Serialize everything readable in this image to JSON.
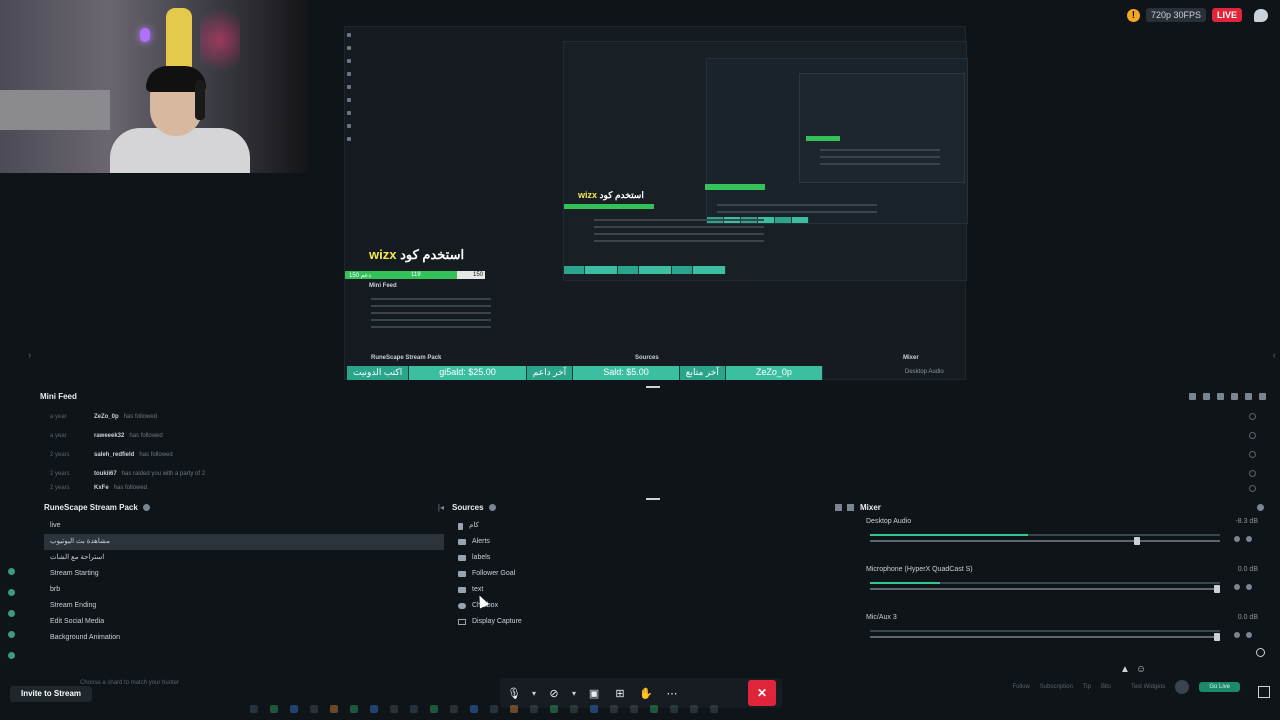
{
  "status": {
    "quality": "720p 30FPS",
    "live": "LIVE"
  },
  "preview": {
    "promo_text": "استخدم كود",
    "promo_code": "wizx",
    "ticker": [
      {
        "label": "اكتب الدونيت",
        "alt": false
      },
      {
        "label": "gi5ald: $25.00",
        "alt": true
      },
      {
        "label": "آخر داعم",
        "alt": false
      },
      {
        "label": "Sald: $5.00",
        "alt": true
      },
      {
        "label": "آخر متابع",
        "alt": false
      },
      {
        "label": "ZeZo_0p",
        "alt": true
      }
    ],
    "bar_left": "150 دعم",
    "bar_mid": "119",
    "bar_right": "150",
    "mini_feed_label": "Mini Feed",
    "rs_pack_label": "RuneScape Stream Pack",
    "sources_label": "Sources",
    "mixer_label": "Mixer",
    "desktop_audio_label": "Desktop Audio"
  },
  "minifeed": {
    "title": "Mini Feed",
    "rows": [
      {
        "time": "a year",
        "user": "ZeZo_0p",
        "action": "has followed"
      },
      {
        "time": "a year",
        "user": "raweeek32",
        "action": "has followed"
      },
      {
        "time": "2 years",
        "user": "saleh_redfield",
        "action": "has followed"
      },
      {
        "time": "2 years",
        "user": "toukii67",
        "action": "has raided you with a party of 2"
      },
      {
        "time": "2 years",
        "user": "KxFe",
        "action": "has followed"
      }
    ]
  },
  "scenes": {
    "title": "RuneScape Stream Pack",
    "items": [
      {
        "label": "live",
        "active": false
      },
      {
        "label": "مشاهدة بث اليوتيوب",
        "active": true
      },
      {
        "label": "استراحة مع الشات",
        "active": false
      },
      {
        "label": "Stream Starting",
        "active": false
      },
      {
        "label": "brb",
        "active": false
      },
      {
        "label": "Stream Ending",
        "active": false
      },
      {
        "label": "Edit Social Media",
        "active": false
      },
      {
        "label": "Background Animation",
        "active": false
      }
    ]
  },
  "sources": {
    "title": "Sources",
    "items": [
      {
        "label": "كام",
        "icon": "lock-icon"
      },
      {
        "label": "Alerts",
        "icon": "folder-icon"
      },
      {
        "label": "labels",
        "icon": "folder-icon"
      },
      {
        "label": "Follower Goal",
        "icon": "folder-icon"
      },
      {
        "label": "text",
        "icon": "folder-icon"
      },
      {
        "label": "Chatbox",
        "icon": "chat-icon"
      },
      {
        "label": "Display Capture",
        "icon": "monitor-icon"
      }
    ]
  },
  "mixer": {
    "title": "Mixer",
    "channels": [
      {
        "label": "Desktop Audio",
        "db": "-8.3 dB",
        "level": 0.45,
        "volume": 0.77
      },
      {
        "label": "Microphone (HyperX QuadCast S)",
        "db": "0.0 dB",
        "level": 0.2,
        "volume": 1.0
      },
      {
        "label": "Mic/Aux 3",
        "db": "0.0 dB",
        "level": 0.0,
        "volume": 1.0
      }
    ]
  },
  "footer": {
    "invite": "Invite to Stream",
    "invite_hint": "Choose a shard to match your hunter",
    "right_items": [
      "Follow",
      "Subscription",
      "Tip",
      "Bits",
      "Test Widgets"
    ],
    "go_live": "Go Live"
  },
  "colors": {
    "accent": "#35c58e",
    "live": "#e0243a",
    "background": "#0e1418"
  }
}
